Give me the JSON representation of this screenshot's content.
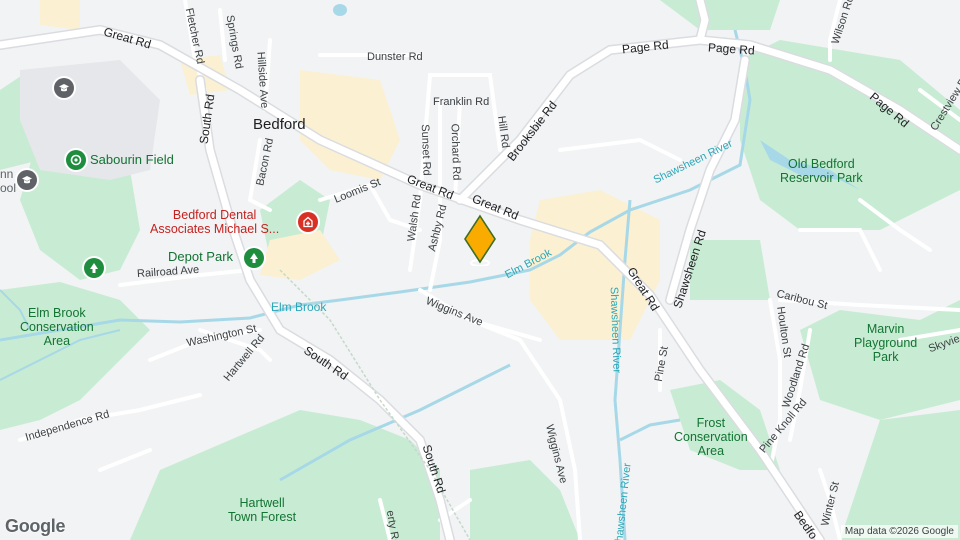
{
  "map": {
    "place": "Bedford",
    "colors": {
      "water": "#a7d8e8",
      "park": "#c8ecd3",
      "commercial": "#fbf0d2",
      "road": "#ffffff",
      "marker": "#f9ab00"
    }
  },
  "roads": {
    "great_rd_w": "Great Rd",
    "great_rd_mid": "Great Rd",
    "great_rd_e": "Great Rd",
    "great_rd_se": "Great Rd",
    "great_rd_se2": "Bedfo",
    "page_rd_1": "Page Rd",
    "page_rd_2": "Page Rd",
    "page_rd_3": "Page Rd",
    "fletcher_rd": "Fletcher Rd",
    "springs_rd": "Springs Rd",
    "hillside_ave": "Hillside Ave",
    "dunster_rd": "Dunster Rd",
    "franklin_rd": "Franklin Rd",
    "orchard_rd": "Orchard Rd",
    "sunset_rd": "Sunset Rd",
    "hill_rd": "Hill Rd",
    "brooksbie_rd": "Brooksbie Rd",
    "south_rd_n": "South Rd",
    "south_rd_mid": "South Rd",
    "south_rd_s": "South Rd",
    "bacon_rd": "Bacon Rd",
    "loomis_st": "Loomis St",
    "walsh_rd": "Walsh Rd",
    "ashby_rd": "Ashby Rd",
    "railroad_ave": "Railroad Ave",
    "wiggins_ave_n": "Wiggins Ave",
    "wiggins_ave_s": "Wiggins Ave",
    "washington_st": "Washington St",
    "hartwell_rd": "Hartwell Rd",
    "independence_rd": "Independence Rd",
    "shawsheen_rd": "Shawsheen Rd",
    "caribou_st": "Caribou St",
    "houlton_st": "Houlton St",
    "woodland_rd": "Woodland Rd",
    "pine_st": "Pine St",
    "pine_knoll_rd": "Pine Knoll Rd",
    "wilson_rd": "Wilson Rd",
    "crestview_rd": "Crestview Rd",
    "winter_st": "Winter St",
    "skyview": "Skyvie",
    "liberty_rd": "erty Rd"
  },
  "water": {
    "elm_brook_w": "Elm Brook",
    "elm_brook_e": "Elm Brook",
    "shawsheen_river_n": "Shawsheen River",
    "shawsheen_river_mid": "Shawsheen River",
    "shawsheen_river_s": "Shawsheen River"
  },
  "parks": {
    "sabourin_field": "Sabourin Field",
    "depot_park": "Depot Park",
    "elm_brook_conservation": "Elm Brook\nConservation\nArea",
    "old_bedford_reservoir": "Old Bedford\nReservoir Park",
    "marvin_playground": "Marvin\nPlayground\nPark",
    "frost_conservation": "Frost\nConservation\nArea",
    "hartwell_town_forest": "Hartwell\nTown Forest"
  },
  "pois": {
    "bedford_dental": "Bedford Dental\nAssociates Michael S...",
    "school_partial": "nn\nool"
  },
  "icons": {
    "park_pin": "tree-icon",
    "school_pin": "graduation-cap-icon",
    "dental_pin": "medical-cross-icon",
    "sports_pin": "sports-field-icon",
    "selected_marker": "diamond-marker-icon"
  },
  "footer": {
    "logo": "Google",
    "attribution": "Map data ©2026 Google"
  }
}
